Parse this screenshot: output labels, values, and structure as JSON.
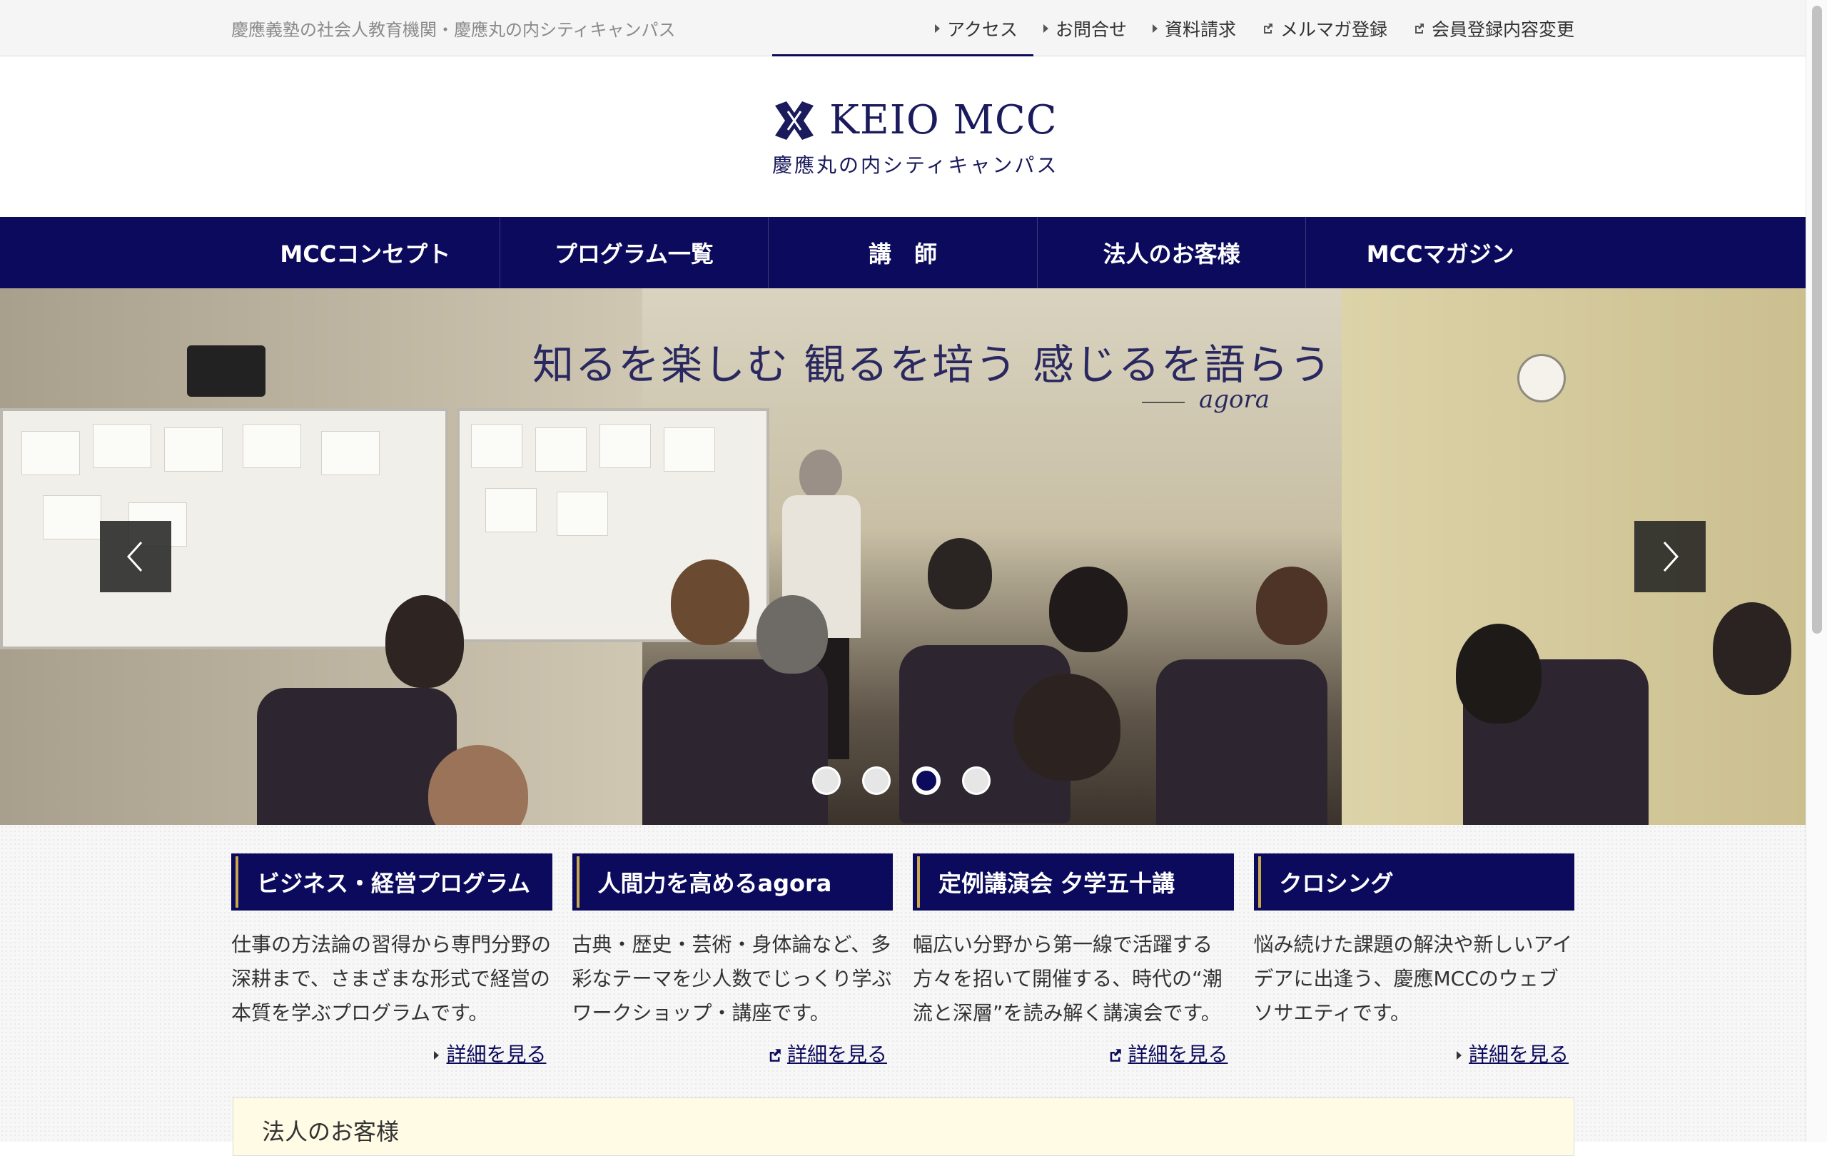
{
  "topbar": {
    "tagline": "慶應義塾の社会人教育機関・慶應丸の内シティキャンパス",
    "links": [
      {
        "label": "アクセス",
        "icon": "triangle-right-icon"
      },
      {
        "label": "お問合せ",
        "icon": "triangle-right-icon"
      },
      {
        "label": "資料請求",
        "icon": "triangle-right-icon"
      },
      {
        "label": "メルマガ登録",
        "icon": "external-link-icon"
      },
      {
        "label": "会員登録内容変更",
        "icon": "external-link-icon"
      }
    ]
  },
  "logo": {
    "text": "KEIO MCC",
    "sub": "慶應丸の内シティキャンパス",
    "color": "#1a1a5c"
  },
  "nav": {
    "items": [
      "MCCコンセプト",
      "プログラム一覧",
      "講　師",
      "法人のお客様",
      "MCCマガジン"
    ],
    "background": "#0c0a5c"
  },
  "hero": {
    "title": "知るを楽しむ 観るを培う 感じるを語らう",
    "subtitle": "agora",
    "slides": 4,
    "active_slide": 3
  },
  "cards": [
    {
      "title": "ビジネス・経営プログラム",
      "body": "仕事の方法論の習得から専門分野の深耕まで、さまざまな形式で経営の本質を学ぶプログラムです。",
      "link": "詳細を見る",
      "link_icon": "triangle-right-icon"
    },
    {
      "title": "人間力を高めるagora",
      "body": "古典・歴史・芸術・身体論など、多彩なテーマを少人数でじっくり学ぶワークショップ・講座です。",
      "link": "詳細を見る",
      "link_icon": "external-link-icon"
    },
    {
      "title": "定例講演会 夕学五十講",
      "body": "幅広い分野から第一線で活躍する方々を招いて開催する、時代の“潮流と深層”を読み解く講演会です。",
      "link": "詳細を見る",
      "link_icon": "external-link-icon"
    },
    {
      "title": "クロシング",
      "body": "悩み続けた課題の解決や新しいアイデアに出逢う、慶應MCCのウェブソサエティです。",
      "link": "詳細を見る",
      "link_icon": "triangle-right-icon"
    }
  ],
  "corporate": {
    "title": "法人のお客様"
  }
}
